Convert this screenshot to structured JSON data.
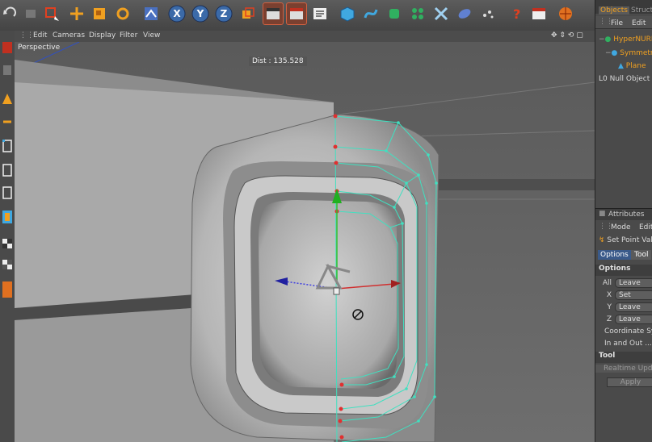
{
  "toolbar": {
    "buttons": [
      "undo-icon",
      "redo-icon",
      "select-icon",
      "move-icon",
      "scale-icon",
      "rotate-icon",
      "recent-icon",
      "x-axis-icon",
      "y-axis-icon",
      "z-axis-icon",
      "world-icon",
      "clapboard-icon",
      "render-active-icon",
      "render-settings-icon",
      "cube-icon",
      "spline-icon",
      "nurbs-icon",
      "array-icon",
      "deformer-icon",
      "scene-icon",
      "fx-icon",
      "help-icon",
      "layout-icon",
      "python-icon"
    ],
    "axes": [
      "X",
      "Y",
      "Z"
    ]
  },
  "viewport": {
    "menu": [
      "Edit",
      "Cameras",
      "Display",
      "Filter",
      "View"
    ],
    "label": "Perspective",
    "dist": "Dist : 135.528"
  },
  "objects_panel": {
    "tabs": [
      "Objects",
      "Structure"
    ],
    "menu": [
      "File",
      "Edit"
    ],
    "items": [
      "HyperNURBS",
      "Symmetry",
      "Plane",
      "Null Object"
    ]
  },
  "attributes_panel": {
    "title": "Attributes",
    "menu": [
      "Mode",
      "Edit"
    ],
    "tool_name": "Set Point Value",
    "tabs": [
      "Options",
      "Tool"
    ],
    "options_header": "Options",
    "fields": [
      {
        "label": "All",
        "value": "Leave"
      },
      {
        "label": "X",
        "value": "Set"
      },
      {
        "label": "Y",
        "value": "Leave"
      },
      {
        "label": "Z",
        "value": "Leave"
      }
    ],
    "coord_label": "Coordinate System",
    "in_out_label": "In and Out ...",
    "tool_header": "Tool",
    "realtime_label": "Realtime Update",
    "apply_label": "Apply"
  },
  "colors": {
    "accent": "#d06040",
    "selection": "#40e0c0",
    "panel": "#4a4a4a"
  }
}
